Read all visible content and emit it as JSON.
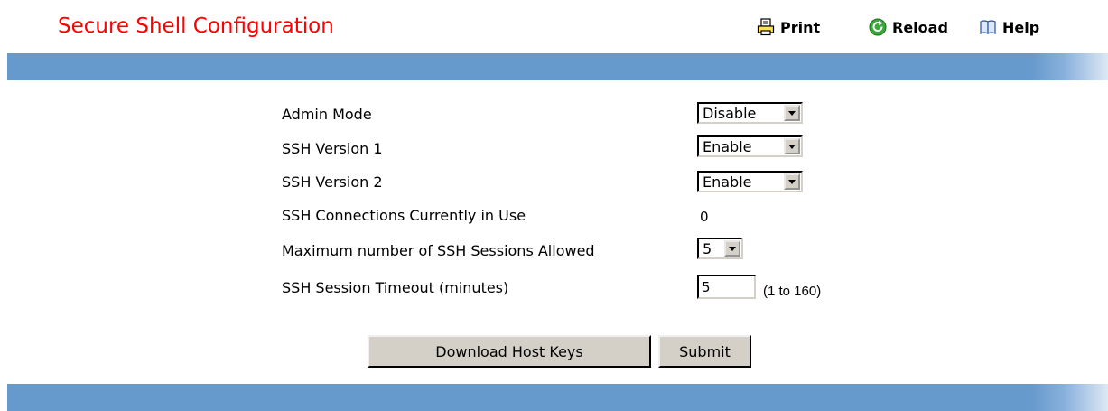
{
  "header": {
    "title": "Secure Shell Configuration",
    "print_label": "Print",
    "reload_label": "Reload",
    "help_label": "Help"
  },
  "form": {
    "admin_mode": {
      "label": "Admin Mode",
      "value": "Disable"
    },
    "ssh_v1": {
      "label": "SSH Version 1",
      "value": "Enable"
    },
    "ssh_v2": {
      "label": "SSH Version 2",
      "value": "Enable"
    },
    "connections": {
      "label": "SSH Connections Currently in Use",
      "value": "0"
    },
    "max_sessions": {
      "label": "Maximum number of SSH Sessions Allowed",
      "value": "5"
    },
    "timeout": {
      "label": "SSH Session Timeout (minutes)",
      "value": "5",
      "range": "(1 to 160)"
    }
  },
  "buttons": {
    "download_label": "Download Host Keys",
    "submit_label": "Submit"
  },
  "colors": {
    "title": "#ff0000",
    "bar": "#6699cc",
    "button_face": "#d4d0c8"
  },
  "icons": {
    "print": "printer-icon",
    "reload": "reload-icon",
    "help": "book-icon"
  }
}
